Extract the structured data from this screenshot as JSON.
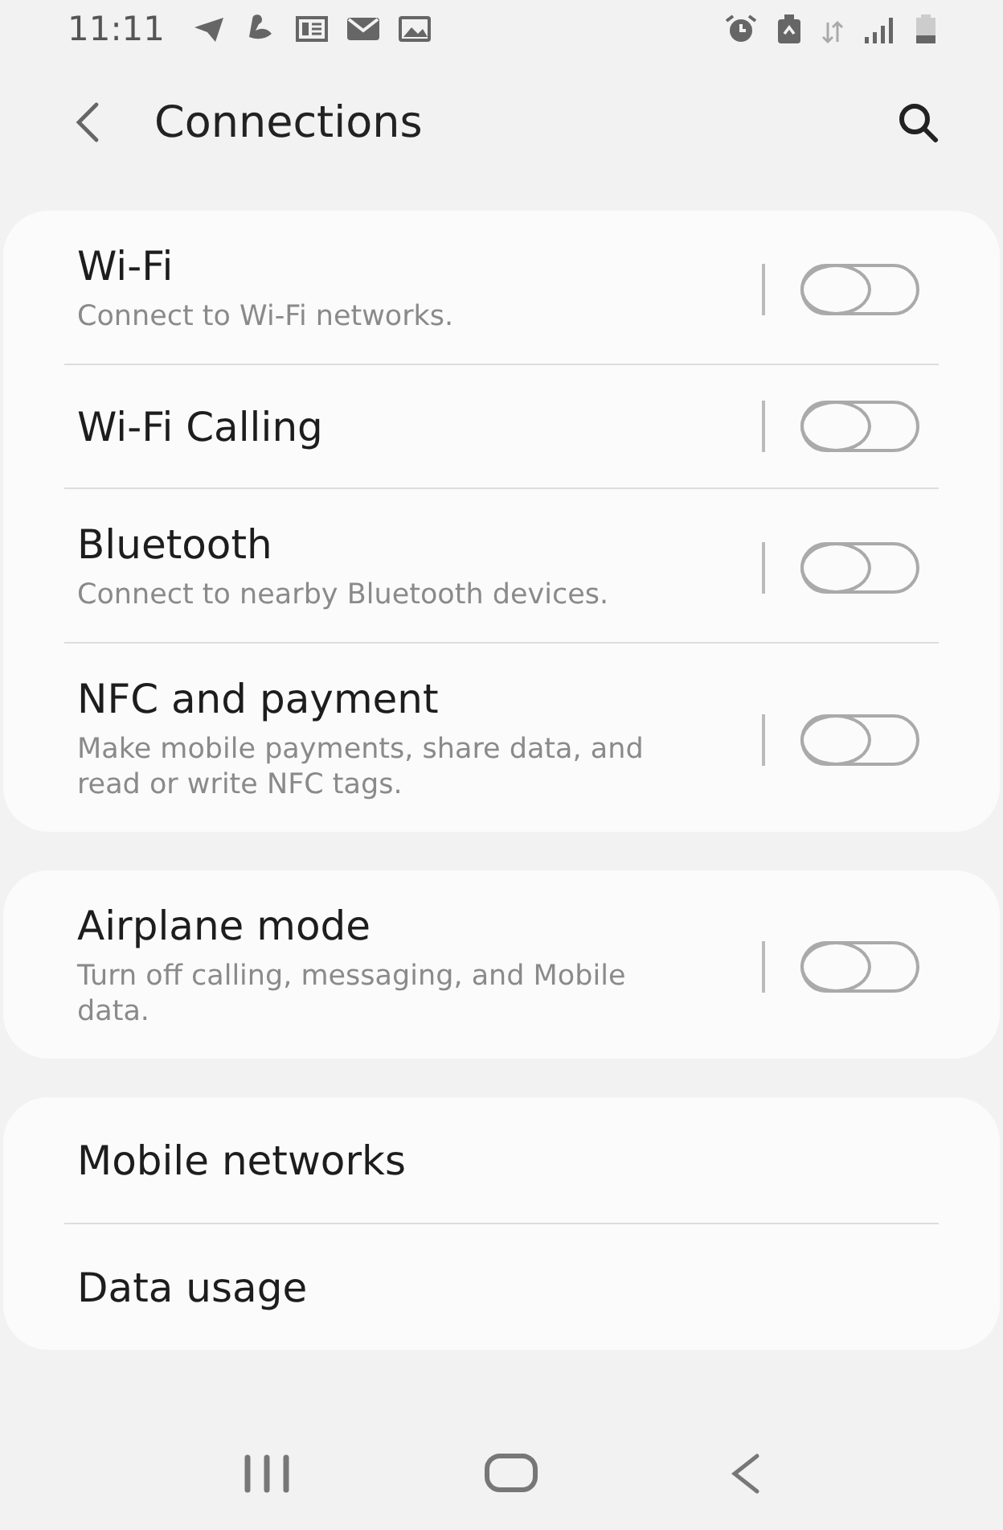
{
  "status_bar": {
    "time": "11:11"
  },
  "header": {
    "title": "Connections"
  },
  "groups": [
    {
      "items": [
        {
          "kind": "toggle",
          "title": "Wi-Fi",
          "subtitle": "Connect to Wi-Fi networks.",
          "on": false
        },
        {
          "kind": "toggle",
          "title": "Wi-Fi Calling",
          "on": false
        },
        {
          "kind": "toggle",
          "title": "Bluetooth",
          "subtitle": "Connect to nearby Bluetooth devices.",
          "on": false
        },
        {
          "kind": "toggle",
          "title": "NFC and payment",
          "subtitle": "Make mobile payments, share data, and read or write NFC tags.",
          "on": false
        }
      ]
    },
    {
      "items": [
        {
          "kind": "toggle",
          "title": "Airplane mode",
          "subtitle": "Turn off calling, messaging, and Mobile data.",
          "on": false
        }
      ]
    },
    {
      "items": [
        {
          "kind": "link",
          "title": "Mobile networks"
        },
        {
          "kind": "link",
          "title": "Data usage"
        }
      ]
    }
  ]
}
